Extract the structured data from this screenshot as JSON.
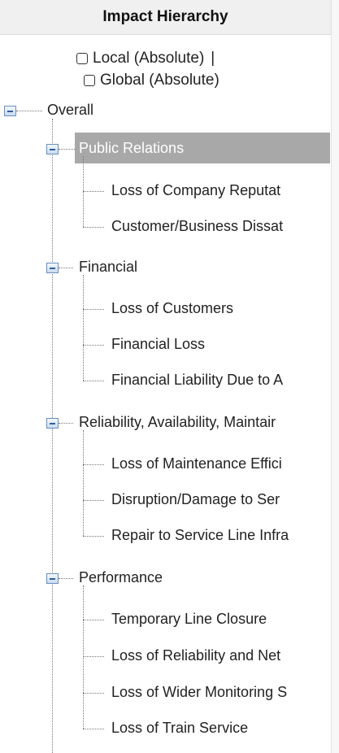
{
  "header": {
    "title": "Impact Hierarchy"
  },
  "options": {
    "local_label": "Local (Absolute)",
    "separator": "|",
    "global_label": "Global (Absolute)"
  },
  "tree": {
    "root": "Overall",
    "groups": [
      {
        "label": "Public Relations",
        "selected": true,
        "items": [
          "Loss of Company Reputat",
          "Customer/Business Dissat"
        ]
      },
      {
        "label": "Financial",
        "items": [
          "Loss of Customers",
          "Financial Loss",
          "Financial Liability Due to A"
        ]
      },
      {
        "label": "Reliability, Availability, Maintair",
        "items": [
          "Loss of Maintenance Effici",
          "Disruption/Damage to Ser",
          "Repair to Service Line Infra"
        ]
      },
      {
        "label": "Performance",
        "items": [
          "Temporary Line Closure",
          "Loss of Reliability and Net",
          "Loss of Wider Monitoring S",
          "Loss of Train Service"
        ]
      }
    ]
  },
  "colors": {
    "selection": "#a8a8a8",
    "toggle_border": "#6a8fbf",
    "toggle_fill": "#c9daf0"
  }
}
